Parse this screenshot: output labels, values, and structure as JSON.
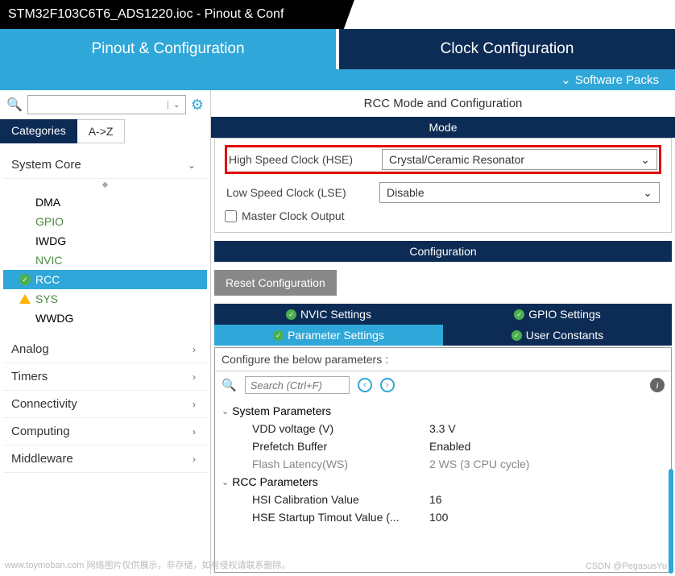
{
  "title": "STM32F103C6T6_ADS1220.ioc - Pinout & Conf",
  "main_tabs": {
    "pinout": "Pinout & Configuration",
    "clock": "Clock Configuration"
  },
  "subbar": "Software Packs",
  "left": {
    "tabs": {
      "categories": "Categories",
      "az": "A->Z"
    },
    "groups": {
      "system_core": "System Core",
      "analog": "Analog",
      "timers": "Timers",
      "connectivity": "Connectivity",
      "computing": "Computing",
      "middleware": "Middleware"
    },
    "items": {
      "dma": "DMA",
      "gpio": "GPIO",
      "iwdg": "IWDG",
      "nvic": "NVIC",
      "rcc": "RCC",
      "sys": "SYS",
      "wwdg": "WWDG"
    }
  },
  "right": {
    "title": "RCC Mode and Configuration",
    "mode_header": "Mode",
    "hse_label": "High Speed Clock (HSE)",
    "hse_value": "Crystal/Ceramic Resonator",
    "lse_label": "Low Speed Clock (LSE)",
    "lse_value": "Disable",
    "master_clock": "Master Clock Output",
    "config_header": "Configuration",
    "reset_btn": "Reset Configuration",
    "tabs": {
      "nvic": "NVIC Settings",
      "gpio": "GPIO Settings",
      "param": "Parameter Settings",
      "user": "User Constants"
    },
    "param_hint": "Configure the below parameters :",
    "search_placeholder": "Search (Ctrl+F)",
    "groups": {
      "sys": "System Parameters",
      "rcc": "RCC Parameters"
    },
    "params": {
      "vdd_k": "VDD voltage (V)",
      "vdd_v": "3.3 V",
      "pre_k": "Prefetch Buffer",
      "pre_v": "Enabled",
      "fl_k": "Flash Latency(WS)",
      "fl_v": "2 WS (3 CPU cycle)",
      "hsi_k": "HSI Calibration Value",
      "hsi_v": "16",
      "hse_k": "HSE Startup Timout Value (...",
      "hse_v": "100"
    }
  },
  "watermarks": {
    "left": "www.toymoban.com  网络图片仅供展示，非存储，如有侵权请联系删除。",
    "right": "CSDN @PegasusYu"
  }
}
